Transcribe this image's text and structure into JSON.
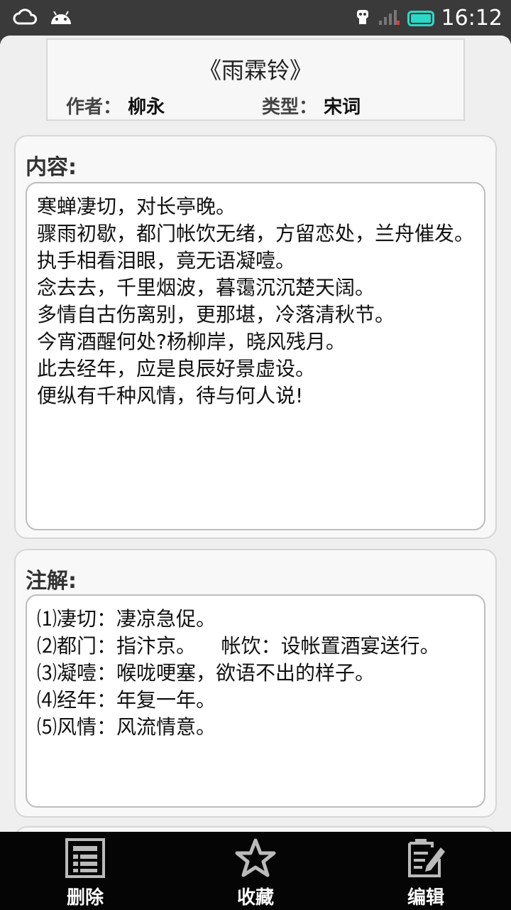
{
  "status_bar": {
    "time": "16:12",
    "icons": [
      "cloud-icon",
      "android-icon",
      "usb-debug-icon",
      "signal-icon",
      "battery-icon"
    ]
  },
  "poem": {
    "title": "《雨霖铃》",
    "author_label": "作者：",
    "author": "柳永",
    "type_label": "类型：",
    "type": "宋词"
  },
  "content": {
    "label": "内容:",
    "lines": [
      "寒蝉凄切，对长亭晚。",
      "骤雨初歇，都门帐饮无绪，方留恋处，兰舟催发。",
      "执手相看泪眼，竟无语凝噎。",
      "念去去，千里烟波，暮霭沉沉楚天阔。",
      "多情自古伤离别，更那堪，冷落清秋节。",
      "今宵酒醒何处?杨柳岸，晓风残月。",
      "此去经年，应是良辰好景虚设。",
      "便纵有千种风情，待与何人说!"
    ]
  },
  "notes": {
    "label": "注解:",
    "lines": [
      "⑴凄切：凄凉急促。",
      "⑵都门：指汴京。    帐饮：设帐置酒宴送行。",
      "⑶凝噎：喉咙哽塞，欲语不出的样子。",
      "⑷经年：年复一年。",
      "⑸风情：风流情意。"
    ]
  },
  "bottom_bar": {
    "delete": "删除",
    "favorite": "收藏",
    "edit": "编辑"
  },
  "colors": {
    "status_bg": "#3a3a3a",
    "page_bg": "#efefef",
    "battery": "#2bd9c7",
    "bottom_bg": "#050505"
  }
}
